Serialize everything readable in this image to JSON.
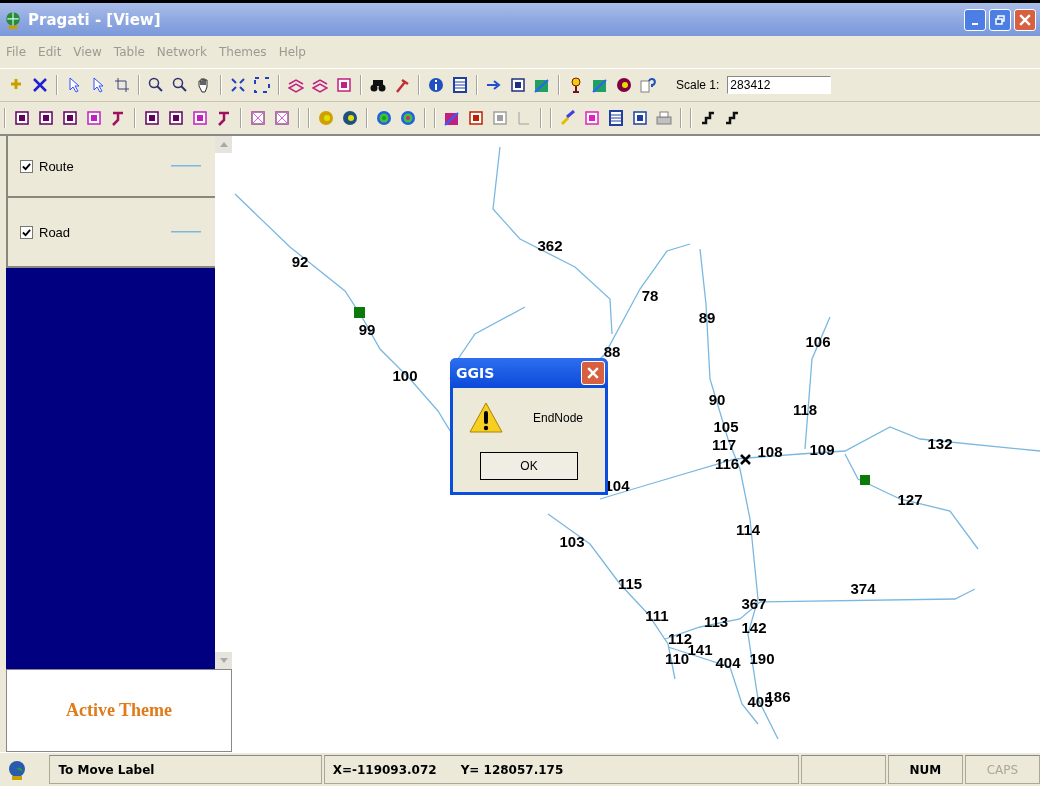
{
  "window": {
    "title": "Pragati - [View]"
  },
  "menu": [
    {
      "label": "File",
      "disabled": true
    },
    {
      "label": "Edit",
      "disabled": true
    },
    {
      "label": "View",
      "disabled": true
    },
    {
      "label": "Table",
      "disabled": true
    },
    {
      "label": "Network",
      "disabled": true
    },
    {
      "label": "Themes",
      "disabled": true
    },
    {
      "label": "Help",
      "disabled": true
    }
  ],
  "scale": {
    "label": "Scale 1:",
    "value": "283412"
  },
  "layers": [
    {
      "name": "Route",
      "checked": true
    },
    {
      "name": "Road",
      "checked": true
    }
  ],
  "active_theme": {
    "label": "Active Theme"
  },
  "map_labels": [
    "362",
    "92",
    "78",
    "89",
    "99",
    "106",
    "88",
    "100",
    "90",
    "118",
    "105",
    "117",
    "108",
    "109",
    "132",
    "116",
    "104",
    "127",
    "114",
    "103",
    "115",
    "374",
    "367",
    "111",
    "113",
    "142",
    "112",
    "141",
    "110",
    "404",
    "190",
    "186",
    "405"
  ],
  "dialog": {
    "title": "GGIS",
    "message": "EndNode",
    "button": "OK"
  },
  "status_bar": {
    "message": "To Move Label",
    "x": "X=-119093.072",
    "y": "Y= 128057.175",
    "keys": [
      {
        "label": "NUM",
        "on": true
      },
      {
        "label": "CAPS",
        "on": false
      }
    ]
  }
}
